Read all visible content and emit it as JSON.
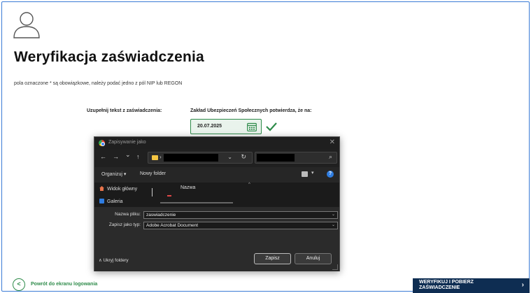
{
  "page": {
    "title": "Weryfikacja zaświadczenia",
    "note": "pola oznaczone * są obowiązkowe, należy podać jedno z pól NIP lub REGON",
    "label_left": "Uzupełnij tekst z zaświadczenia:",
    "label_right": "Zakład Ubezpieczeń Społecznych potwierdza, że na:",
    "date_value": "20.07.2025"
  },
  "dialog": {
    "title": "Zapisywanie jako",
    "close": "✕",
    "nav": {
      "back": "←",
      "forward": "→",
      "down": "⌄",
      "up": "↑",
      "crumb_arrow": "›",
      "chevron": "⌄",
      "refresh": "↻",
      "search": "⌕"
    },
    "toolbar": {
      "organize": "Organizuj ▾",
      "new_folder": "Nowy folder",
      "view_chevron": "▾",
      "help": "?"
    },
    "sidebar": [
      {
        "label": "Widok główny",
        "icon": "home-icon"
      },
      {
        "label": "Galeria",
        "icon": "gallery-icon"
      }
    ],
    "column_header": "Nazwa",
    "filename_label": "Nazwa pliku:",
    "filename_value": "zaswiadczenie",
    "filetype_label": "Zapisz jako typ:",
    "filetype_value": "Adobe Acrobat Document",
    "hide_folders": "∧  Ukryj foldery",
    "save": "Zapisz",
    "cancel": "Anuluj",
    "dropdown": "⌄"
  },
  "footer": {
    "back_label": "Powrót do ekranu logowania",
    "back_icon": "<",
    "verify_label": "WERYFIKUJ I POBIERZ ZAŚWIADCZENIE",
    "verify_line1": "WERYFIKUJ I POBIERZ",
    "verify_line2": "ZAŚWIADCZENIE",
    "verify_arrow": "›"
  },
  "colors": {
    "accent_green": "#2e8b4a",
    "dark_navy": "#0e2d52",
    "frame_blue": "#3a7bd5"
  }
}
